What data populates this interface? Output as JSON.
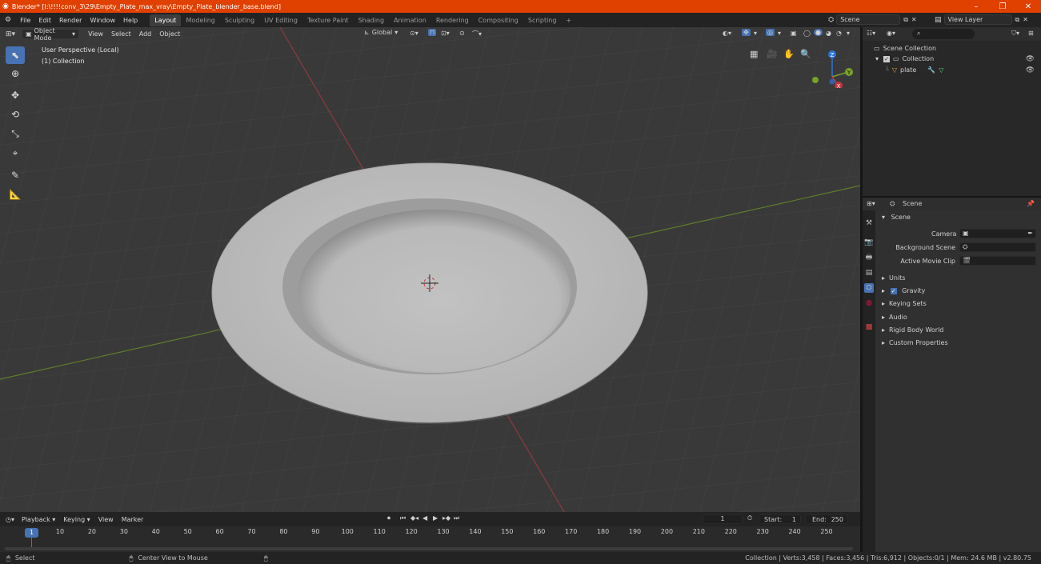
{
  "window": {
    "title": "Blender* [I:\\!!!!conv_3\\29\\Empty_Plate_max_vray\\Empty_Plate_blender_base.blend]",
    "minimize": "–",
    "restore": "❐",
    "close": "✕"
  },
  "menus": [
    "File",
    "Edit",
    "Render",
    "Window",
    "Help"
  ],
  "workspaces": [
    "Layout",
    "Modeling",
    "Sculpting",
    "UV Editing",
    "Texture Paint",
    "Shading",
    "Animation",
    "Rendering",
    "Compositing",
    "Scripting"
  ],
  "active_workspace": "Layout",
  "scene_selector": {
    "label": "Scene"
  },
  "view_layer_selector": {
    "label": "View Layer"
  },
  "viewport": {
    "mode": "Object Mode",
    "menus": [
      "View",
      "Select",
      "Add",
      "Object"
    ],
    "orientation": "Global",
    "info_line1": "User Perspective (Local)",
    "info_line2": "(1) Collection"
  },
  "gizmo": {
    "z": "Z",
    "y": "Y",
    "x": "X"
  },
  "outliner": {
    "search_placeholder": "",
    "root": "Scene Collection",
    "collection": "Collection",
    "object": "plate"
  },
  "properties": {
    "context": "Scene",
    "panel": "Scene",
    "camera_label": "Camera",
    "background_scene_label": "Background Scene",
    "active_movie_clip_label": "Active Movie Clip",
    "sections": [
      "Units",
      "Gravity",
      "Keying Sets",
      "Audio",
      "Rigid Body World",
      "Custom Properties"
    ],
    "gravity_checked": true
  },
  "timeline": {
    "menus": [
      "Playback",
      "Keying",
      "View",
      "Marker"
    ],
    "current_frame": "1",
    "start_label": "Start:",
    "start_value": "1",
    "end_label": "End:",
    "end_value": "250",
    "ticks": [
      "10",
      "20",
      "30",
      "40",
      "50",
      "60",
      "70",
      "80",
      "90",
      "100",
      "110",
      "120",
      "130",
      "140",
      "150",
      "160",
      "170",
      "180",
      "190",
      "200",
      "210",
      "220",
      "230",
      "240",
      "250"
    ],
    "playhead": "1"
  },
  "statusbar": {
    "left_action": "Select",
    "middle_action": "Center View to Mouse",
    "stats": "Collection | Verts:3,458 | Faces:3,456 | Tris:6,912 | Objects:0/1 | Mem: 24.6 MB | v2.80.75"
  },
  "colors": {
    "titlebar": "#e04000",
    "accent": "#4772b3",
    "axis_x": "#c4343f",
    "axis_y": "#79a12a",
    "axis_z": "#2e73d8"
  }
}
